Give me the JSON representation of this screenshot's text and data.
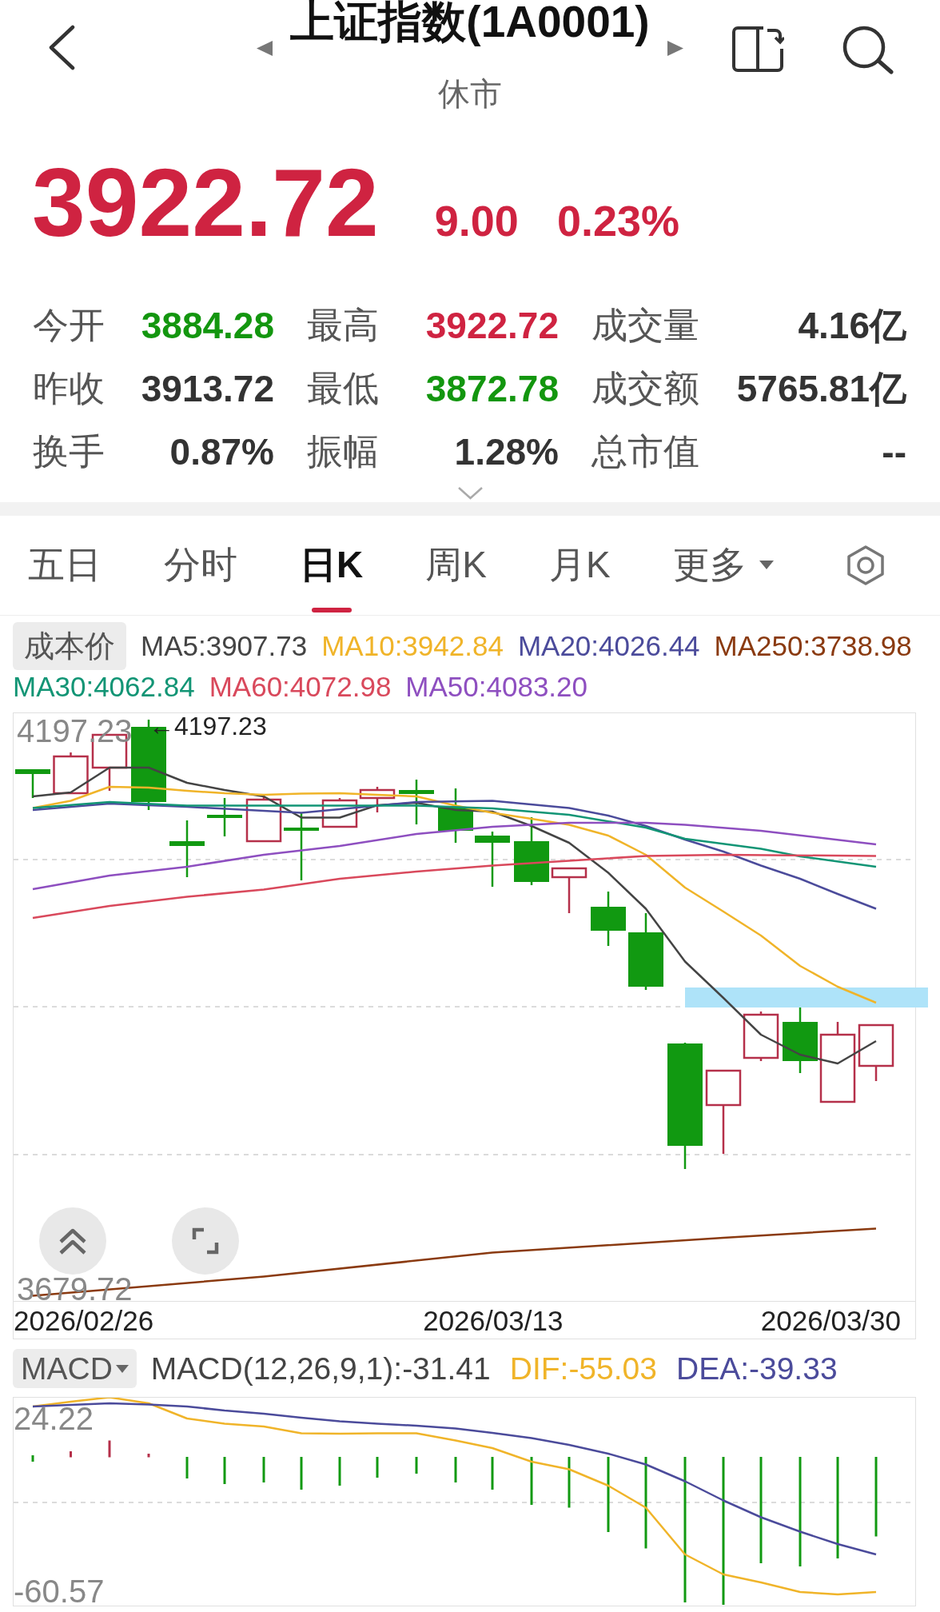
{
  "header": {
    "title": "上证指数(1A0001)",
    "status": "休市"
  },
  "quote": {
    "price": "3922.72",
    "change": "9.00",
    "change_percent": "0.23%",
    "rising": true
  },
  "stats": [
    {
      "label": "今开",
      "value": "3884.28",
      "color": "#13960f"
    },
    {
      "label": "最高",
      "value": "3922.72",
      "color": "#cf2341"
    },
    {
      "label": "成交量",
      "value": "4.16亿",
      "color": "#333333"
    },
    {
      "label": "昨收",
      "value": "3913.72",
      "color": "#333333"
    },
    {
      "label": "最低",
      "value": "3872.78",
      "color": "#13960f"
    },
    {
      "label": "成交额",
      "value": "5765.81亿",
      "color": "#333333"
    },
    {
      "label": "换手",
      "value": "0.87%",
      "color": "#333333"
    },
    {
      "label": "振幅",
      "value": "1.28%",
      "color": "#333333"
    },
    {
      "label": "总市值",
      "value": "--",
      "color": "#333333"
    }
  ],
  "tabs": [
    {
      "label": "五日",
      "kind": "tab",
      "selected": false
    },
    {
      "label": "分时",
      "kind": "tab",
      "selected": false
    },
    {
      "label": "日K",
      "kind": "tab",
      "selected": true
    },
    {
      "label": "周K",
      "kind": "tab",
      "selected": false
    },
    {
      "label": "月K",
      "kind": "tab",
      "selected": false
    },
    {
      "label": "更多",
      "kind": "menu",
      "selected": false
    }
  ],
  "kline": {
    "cost_button": "成本价",
    "legend": [
      {
        "label": "MA5:3907.73",
        "color": "#444444"
      },
      {
        "label": "MA10:3942.84",
        "color": "#f0b429"
      },
      {
        "label": "MA20:4026.44",
        "color": "#4b4b9b"
      },
      {
        "label": "MA250:3738.98",
        "color": "#8a3a10"
      },
      {
        "label": "MA30:4062.84",
        "color": "#129575"
      },
      {
        "label": "MA60:4072.98",
        "color": "#d9495c"
      },
      {
        "label": "MA50:4083.20",
        "color": "#8e4fc0"
      }
    ],
    "y_max": "4197.23",
    "max_marker": "←4197.23",
    "y_min": "3679.72",
    "dates": [
      "2026/02/26",
      "2026/03/13",
      "2026/03/30"
    ]
  },
  "macd": {
    "selector": "MACD",
    "summary": "MACD(12,26,9,1):-31.41",
    "legend": [
      {
        "label": "DIF:-55.03",
        "color": "#f0b429"
      },
      {
        "label": "DEA:-39.33",
        "color": "#4b4b9b"
      }
    ],
    "y_max": "24.22",
    "y_min": "-60.57"
  }
}
